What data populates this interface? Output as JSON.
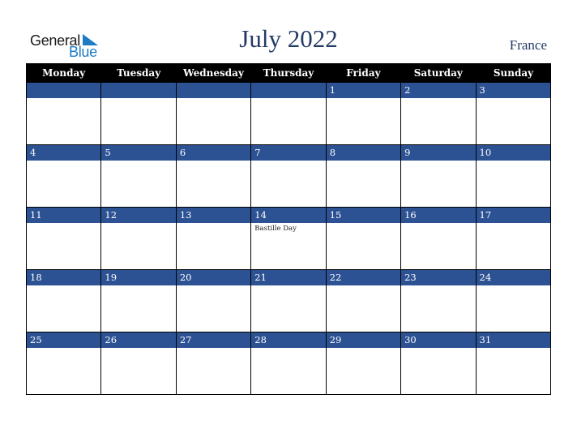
{
  "logo": {
    "word1": "General",
    "word2": "Blue"
  },
  "header": {
    "title": "July 2022",
    "country": "France"
  },
  "colors": {
    "accent": "#2d5294",
    "title": "#233a66",
    "header_bg": "#000000",
    "logo_blue": "#1e7bc4"
  },
  "weekdays": [
    "Monday",
    "Tuesday",
    "Wednesday",
    "Thursday",
    "Friday",
    "Saturday",
    "Sunday"
  ],
  "weeks": [
    [
      {
        "day": ""
      },
      {
        "day": ""
      },
      {
        "day": ""
      },
      {
        "day": ""
      },
      {
        "day": "1"
      },
      {
        "day": "2"
      },
      {
        "day": "3"
      }
    ],
    [
      {
        "day": "4"
      },
      {
        "day": "5"
      },
      {
        "day": "6"
      },
      {
        "day": "7"
      },
      {
        "day": "8"
      },
      {
        "day": "9"
      },
      {
        "day": "10"
      }
    ],
    [
      {
        "day": "11"
      },
      {
        "day": "12"
      },
      {
        "day": "13"
      },
      {
        "day": "14",
        "event": "Bastille Day"
      },
      {
        "day": "15"
      },
      {
        "day": "16"
      },
      {
        "day": "17"
      }
    ],
    [
      {
        "day": "18"
      },
      {
        "day": "19"
      },
      {
        "day": "20"
      },
      {
        "day": "21"
      },
      {
        "day": "22"
      },
      {
        "day": "23"
      },
      {
        "day": "24"
      }
    ],
    [
      {
        "day": "25"
      },
      {
        "day": "26"
      },
      {
        "day": "27"
      },
      {
        "day": "28"
      },
      {
        "day": "29"
      },
      {
        "day": "30"
      },
      {
        "day": "31"
      }
    ]
  ]
}
